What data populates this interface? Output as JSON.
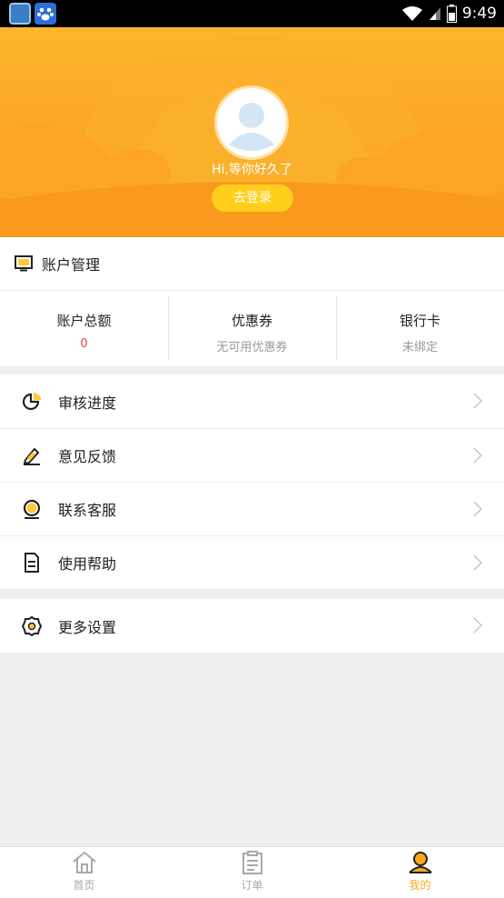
{
  "status_bar": {
    "time": "9:49"
  },
  "header": {
    "greeting": "Hi,等你好久了",
    "login_button": "去登录"
  },
  "account": {
    "title": "账户管理",
    "columns": [
      {
        "label": "账户总额",
        "value": "0"
      },
      {
        "label": "优惠券",
        "value": "无可用优惠券"
      },
      {
        "label": "银行卡",
        "value": "未绑定"
      }
    ]
  },
  "menu": [
    {
      "label": "审核进度",
      "icon": "pie-chart-icon"
    },
    {
      "label": "意见反馈",
      "icon": "pencil-icon"
    },
    {
      "label": "联系客服",
      "icon": "customer-service-icon"
    },
    {
      "label": "使用帮助",
      "icon": "document-icon"
    }
  ],
  "settings": {
    "label": "更多设置",
    "icon": "settings-gear-icon"
  },
  "tabbar": [
    {
      "label": "首页",
      "icon": "home-icon",
      "active": false
    },
    {
      "label": "订单",
      "icon": "clipboard-icon",
      "active": false
    },
    {
      "label": "我的",
      "icon": "user-icon",
      "active": true
    }
  ],
  "colors": {
    "brand_orange": "#fba425",
    "login_yellow": "#ffcf1c",
    "active_tab": "#f9a91e",
    "balance_red": "#e8443b"
  }
}
